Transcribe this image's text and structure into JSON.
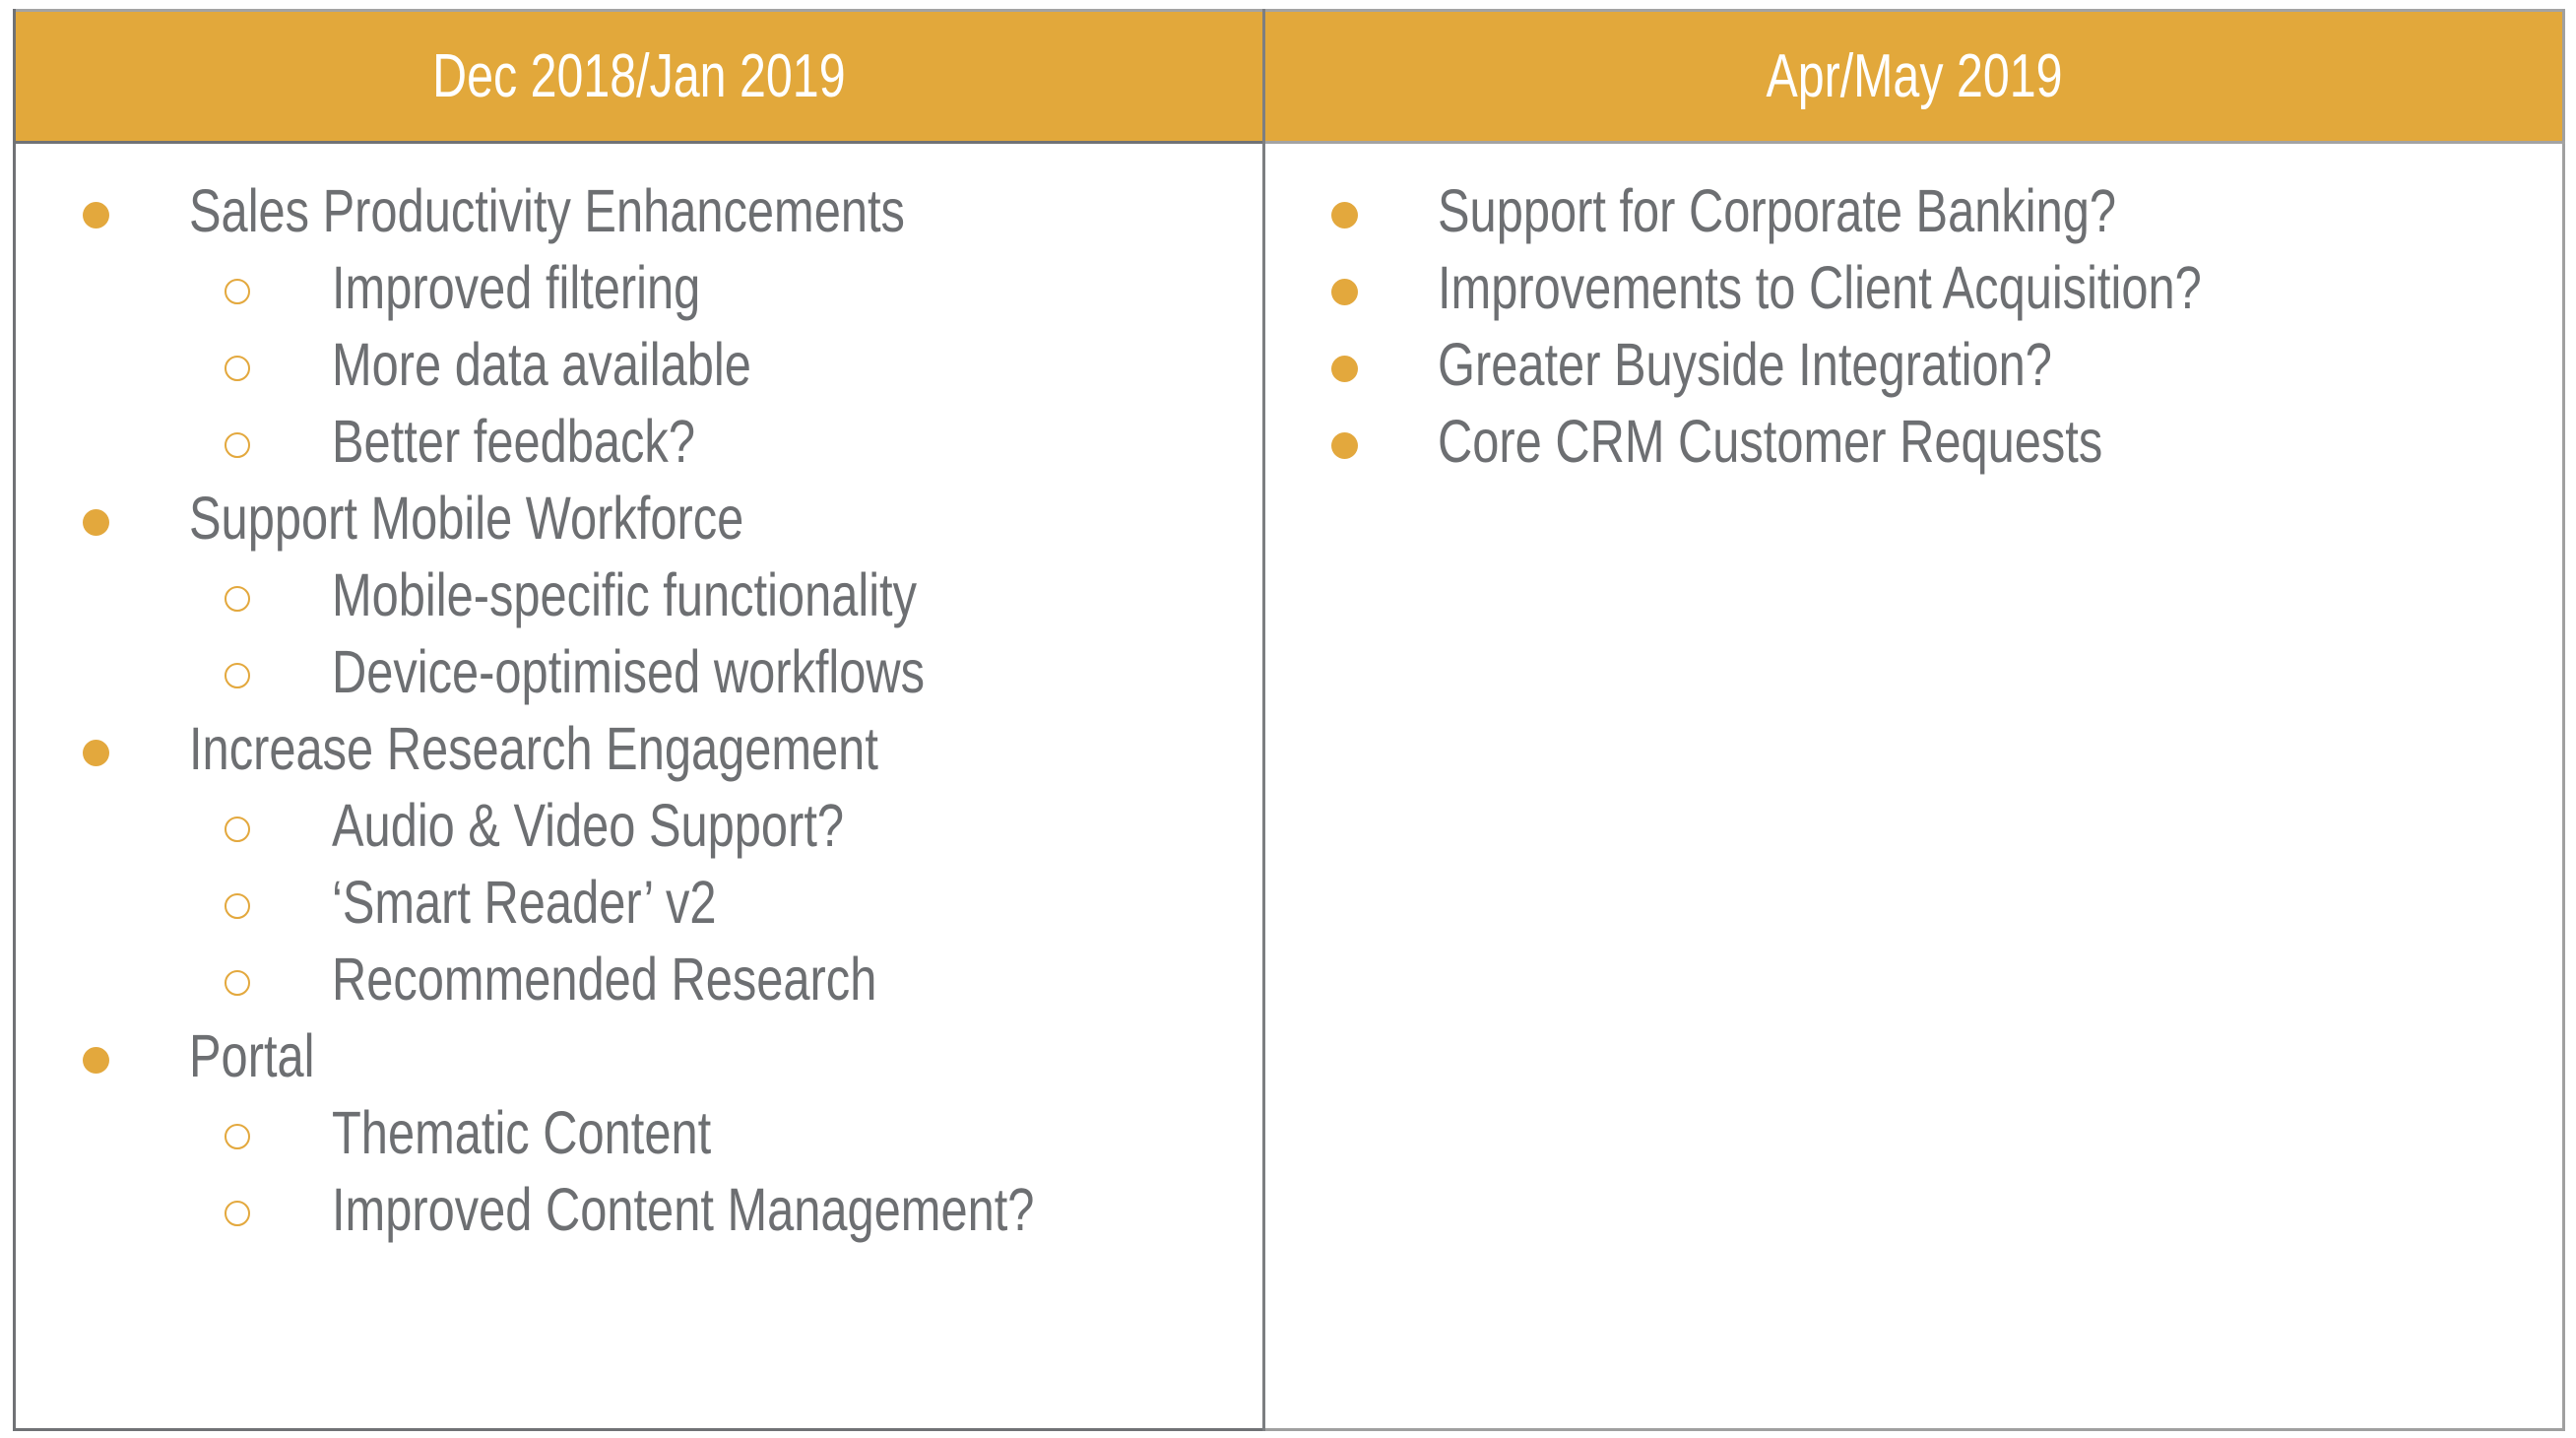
{
  "theme": {
    "accent": "#e2a83b",
    "text_color": "#6d6f72",
    "header_text_color": "#ffffff"
  },
  "columns": [
    {
      "header": "Dec 2018/Jan 2019",
      "items": [
        {
          "level": 1,
          "bullet": "filled-circle-icon",
          "text": "Sales Productivity Enhancements"
        },
        {
          "level": 2,
          "bullet": "hollow-circle-icon",
          "text": "Improved filtering"
        },
        {
          "level": 2,
          "bullet": "hollow-circle-icon",
          "text": "More data available"
        },
        {
          "level": 2,
          "bullet": "hollow-circle-icon",
          "text": "Better feedback?"
        },
        {
          "level": 1,
          "bullet": "filled-circle-icon",
          "text": "Support Mobile Workforce"
        },
        {
          "level": 2,
          "bullet": "hollow-circle-icon",
          "text": "Mobile-specific functionality"
        },
        {
          "level": 2,
          "bullet": "hollow-circle-icon",
          "text": "Device-optimised workflows"
        },
        {
          "level": 1,
          "bullet": "filled-circle-icon",
          "text": "Increase Research Engagement"
        },
        {
          "level": 2,
          "bullet": "hollow-circle-icon",
          "text": "Audio & Video Support?"
        },
        {
          "level": 2,
          "bullet": "hollow-circle-icon",
          "text": "‘Smart Reader’ v2"
        },
        {
          "level": 2,
          "bullet": "hollow-circle-icon",
          "text": "Recommended Research"
        },
        {
          "level": 1,
          "bullet": "filled-circle-icon",
          "text": "Portal"
        },
        {
          "level": 2,
          "bullet": "hollow-circle-icon",
          "text": "Thematic Content"
        },
        {
          "level": 2,
          "bullet": "hollow-circle-icon",
          "text": "Improved Content Management?"
        }
      ]
    },
    {
      "header": "Apr/May 2019",
      "items": [
        {
          "level": 1,
          "bullet": "filled-circle-icon",
          "text": "Support for Corporate Banking?"
        },
        {
          "level": 1,
          "bullet": "filled-circle-icon",
          "text": "Improvements to Client Acquisition?"
        },
        {
          "level": 1,
          "bullet": "filled-circle-icon",
          "text": "Greater Buyside Integration?"
        },
        {
          "level": 1,
          "bullet": "filled-circle-icon",
          "text": "Core CRM Customer Requests"
        }
      ]
    }
  ]
}
